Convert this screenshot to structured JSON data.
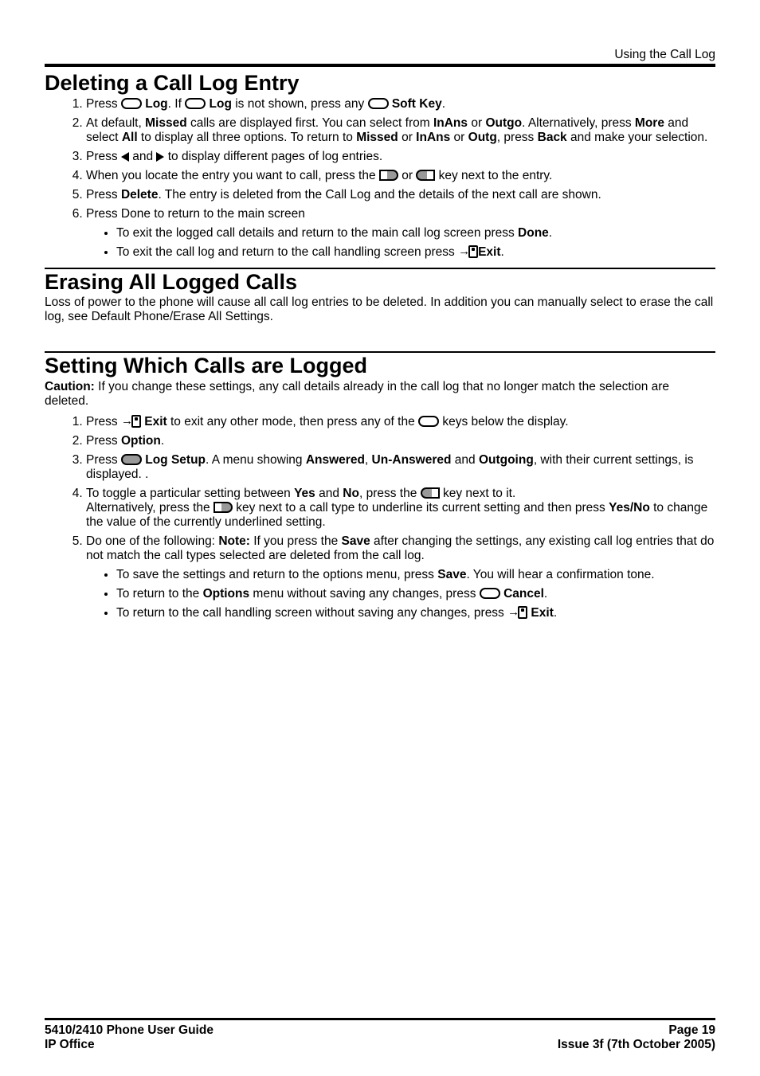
{
  "header": {
    "context": "Using the Call Log"
  },
  "s1": {
    "title": "Deleting a Call Log Entry",
    "steps": {
      "i1a": "Press ",
      "i1b": " Log",
      "i1c": ". If ",
      "i1d": " Log",
      "i1e": " is not shown, press any ",
      "i1f": " Soft Key",
      "i1g": ".",
      "i2a": "At default, ",
      "i2b": "Missed",
      "i2c": " calls are displayed first. You can select from ",
      "i2d": "InAns",
      "i2e": " or ",
      "i2f": "Outgo",
      "i2g": ". Alternatively, press ",
      "i2h": "More",
      "i2i": " and select ",
      "i2j": "All",
      "i2k": " to display all three options. To return to ",
      "i2l": "Missed",
      "i2m": " or ",
      "i2n": "InAns",
      "i2o": " or ",
      "i2p": "Outg",
      "i2q": ", press ",
      "i2r": "Back",
      "i2s": " and make your selection.",
      "i3a": "Press ",
      "i3b": " and ",
      "i3c": " to display different pages of log entries.",
      "i4a": "When you locate the entry you want to call, press the ",
      "i4b": " or ",
      "i4c": " key next to the entry.",
      "i5a": "Press ",
      "i5b": "Delete",
      "i5c": ". The entry is deleted from the Call Log and the details of the next call are shown.",
      "i6a": "Press Done to return to the main screen",
      "i6s1a": "To exit the logged call details and return to the main call log screen press ",
      "i6s1b": "Done",
      "i6s1c": ".",
      "i6s2a": "To exit the call log and return to the call handling screen press ",
      "i6s2b": "Exit",
      "i6s2c": "."
    }
  },
  "s2": {
    "title": "Erasing All Logged Calls",
    "intro": "Loss of power to the phone will cause all call log entries to be deleted. In addition you can manually select to erase the call log, see Default Phone/Erase All Settings."
  },
  "s3": {
    "title": "Setting Which Calls are Logged",
    "cautionLabel": "Caution:",
    "caution": " If you change these settings, any call details already in the call log that no longer match the selection are deleted.",
    "steps": {
      "i1a": "Press ",
      "i1b": " Exit",
      "i1c": " to exit any other mode, then press any of the ",
      "i1d": " keys below the display.",
      "i2a": "Press ",
      "i2b": "Option",
      "i2c": ".",
      "i3a": "Press ",
      "i3b": " Log Setup",
      "i3c": ". A menu showing ",
      "i3d": "Answered",
      "i3e": ", ",
      "i3f": "Un-Answered",
      "i3g": " and ",
      "i3h": "Outgoing",
      "i3i": ", with their current settings, is displayed. .",
      "i4a": "To toggle a particular setting between ",
      "i4b": "Yes",
      "i4c": " and ",
      "i4d": "No",
      "i4e": ", press the ",
      "i4f": " key next to it. ",
      "i4g": "Alternatively, press the ",
      "i4h": " key next to a call type to underline its current setting and then press ",
      "i4i": "Yes/No",
      "i4j": " to change the value of the currently underlined setting.",
      "i5a": "Do one of the following: ",
      "i5b": "Note:",
      "i5c": "  If you press the ",
      "i5d": "Save",
      "i5e": " after changing the settings, any existing call log entries that do not match the call types selected are deleted from the call log.",
      "i5s1a": "To save the settings and return to the options menu, press ",
      "i5s1b": "Save",
      "i5s1c": ". You will hear a confirmation tone.",
      "i5s2a": "To return to the ",
      "i5s2b": "Options",
      "i5s2c": " menu without saving any changes, press ",
      "i5s2d": " Cancel",
      "i5s2e": ".",
      "i5s3a": "To return to the call handling screen without saving any changes, press ",
      "i5s3b": " Exit",
      "i5s3c": "."
    }
  },
  "footer": {
    "guide": "5410/2410 Phone User Guide",
    "product": "IP Office",
    "page": "Page 19",
    "issue": "Issue 3f (7th October 2005)"
  }
}
